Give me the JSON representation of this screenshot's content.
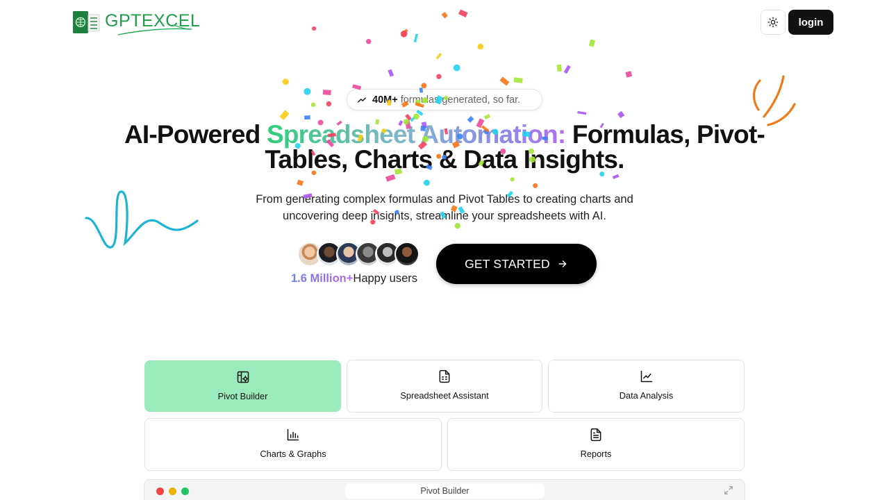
{
  "header": {
    "logo_text": "GPTEXCEL",
    "logo_icon": "excel-logo-icon",
    "theme_icon": "sun-icon",
    "login_label": "login"
  },
  "hero": {
    "counter_bold": "40M+",
    "counter_rest": "formulas generated, so far.",
    "counter_icon": "trend-up-icon",
    "headline_part1": "AI-Powered ",
    "headline_highlight": "Spreadsheet Automation:",
    "headline_part2": " Formulas, Pivot-Tables, Charts & Data Insights.",
    "subtitle": "From generating complex formulas and Pivot Tables to creating charts and uncovering deep insights, streamline your spreadsheets with AI.",
    "users_count": "1.6 Million+",
    "users_label": "Happy users",
    "cta_label": "GET STARTED",
    "cta_icon": "arrow-right-icon"
  },
  "tools": [
    {
      "label": "Pivot Builder",
      "icon": "pivot-table-icon",
      "active": true
    },
    {
      "label": "Spreadsheet Assistant",
      "icon": "spreadsheet-file-icon",
      "active": false
    },
    {
      "label": "Data Analysis",
      "icon": "line-chart-icon",
      "active": false
    },
    {
      "label": "Charts & Graphs",
      "icon": "bar-chart-icon",
      "active": false
    },
    {
      "label": "Reports",
      "icon": "report-document-icon",
      "active": false
    }
  ],
  "preview": {
    "title": "Pivot Builder",
    "expand_icon": "expand-icon"
  },
  "colors": {
    "accent_green": "#9aebbb",
    "brand_green": "#1e9e4a",
    "cta_bg": "#000000",
    "users_gradient_start": "#6f7df2",
    "users_gradient_end": "#b365ee"
  }
}
